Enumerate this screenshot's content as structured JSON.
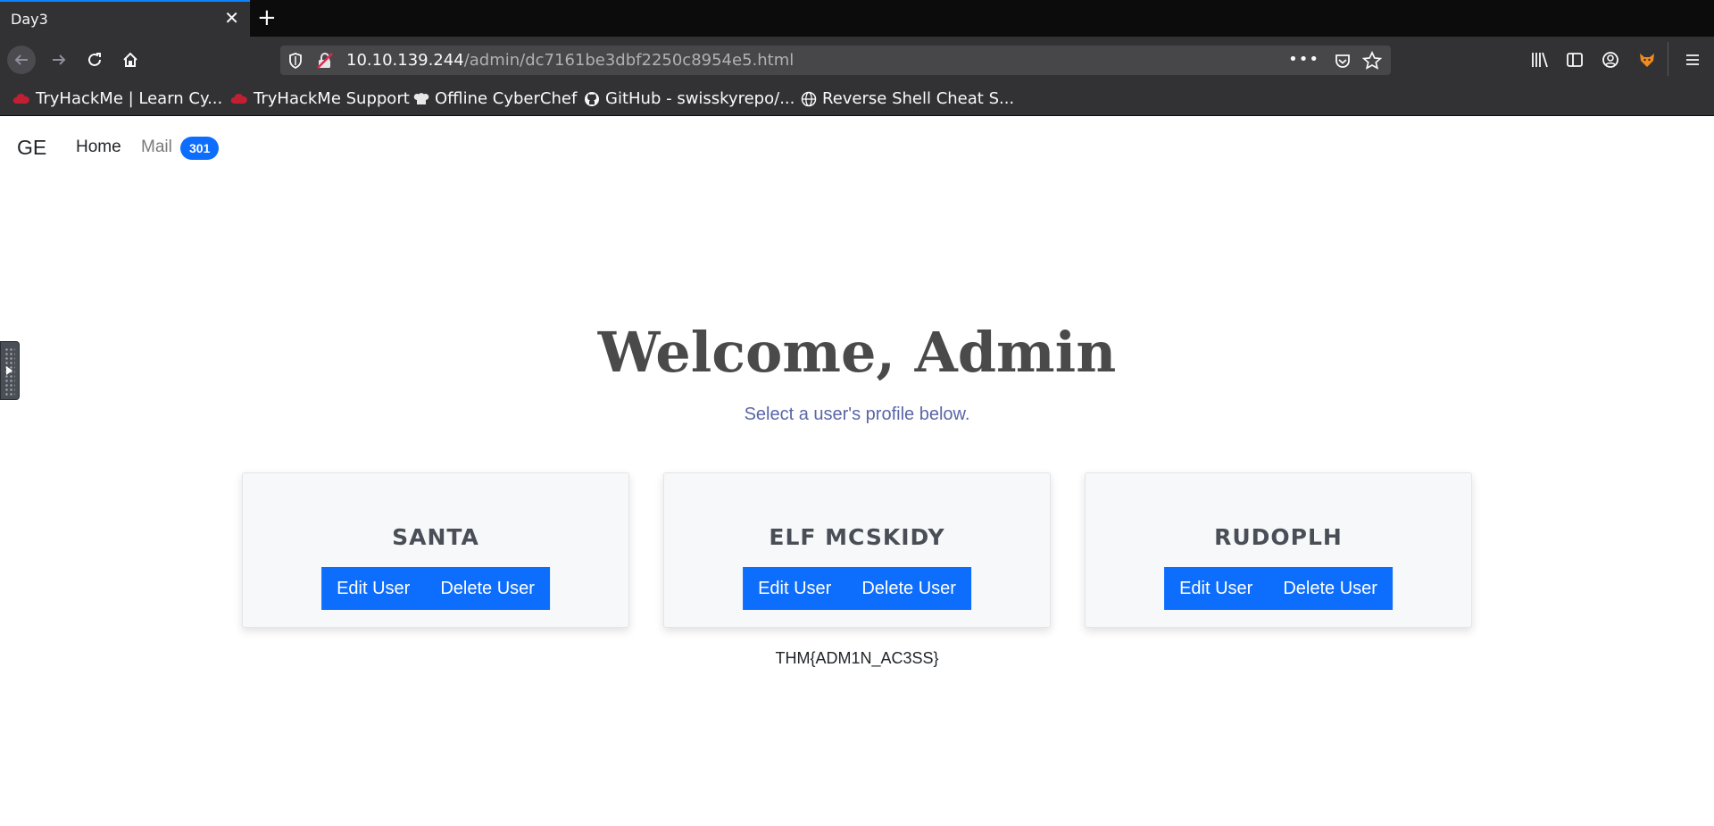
{
  "browser": {
    "tab_title": "Day3",
    "url_host": "10.10.139.244",
    "url_path": "/admin/dc7161be3dbf2250c8954e5.html",
    "url_more": "•••",
    "accent_color": "#0a84ff",
    "bookmarks": [
      {
        "label": "TryHackMe | Learn Cy...",
        "icon": "tryhackme-cloud-icon"
      },
      {
        "label": "TryHackMe Support",
        "icon": "tryhackme-cloud-icon"
      },
      {
        "label": "Offline CyberChef",
        "icon": "chef-hat-icon"
      },
      {
        "label": "GitHub - swisskyrepo/...",
        "icon": "github-icon"
      },
      {
        "label": "Reverse Shell Cheat S...",
        "icon": "globe-icon"
      }
    ]
  },
  "page": {
    "brand": "GE",
    "nav": {
      "home": "Home",
      "mail": "Mail",
      "mail_count": "301"
    },
    "heading": "Welcome, Admin",
    "subtitle": "Select a user's profile below.",
    "users": [
      {
        "name": "SANTA",
        "edit_label": "Edit User",
        "delete_label": "Delete User"
      },
      {
        "name": "ELF MCSKIDY",
        "edit_label": "Edit User",
        "delete_label": "Delete User"
      },
      {
        "name": "RUDOPLH",
        "edit_label": "Edit User",
        "delete_label": "Delete User"
      }
    ],
    "flag": "THM{ADM1N_AC3SS}",
    "button_color": "#0d6efd"
  }
}
